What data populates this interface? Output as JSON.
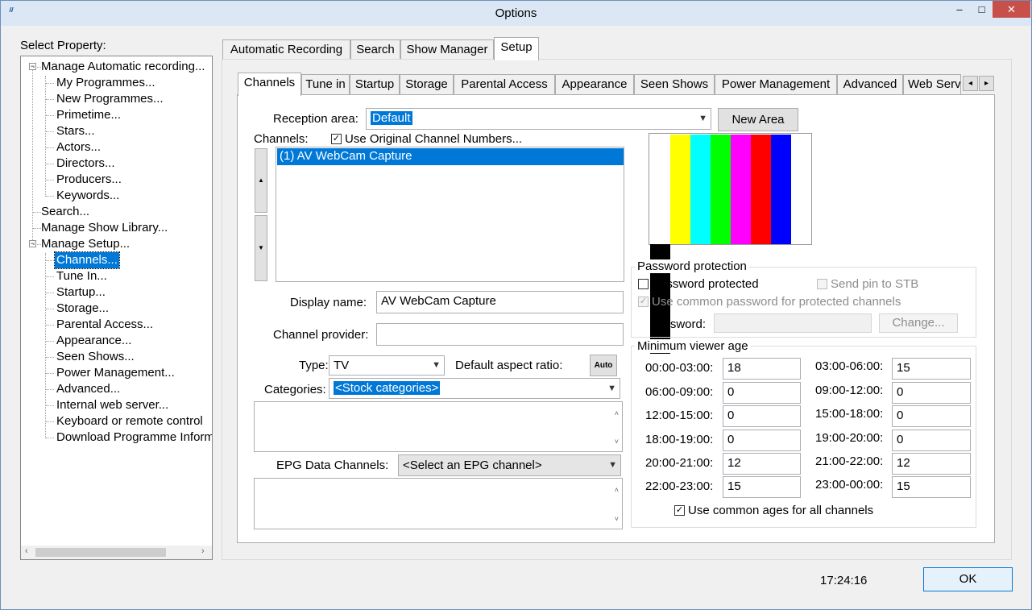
{
  "window": {
    "title": "Options",
    "minimize": "‒",
    "maximize": "□",
    "close": "✕"
  },
  "left": {
    "label": "Select Property:",
    "tree": [
      "Manage Automatic recording...",
      "My Programmes...",
      "New Programmes...",
      "Primetime...",
      "Stars...",
      "Actors...",
      "Directors...",
      "Producers...",
      "Keywords...",
      "Search...",
      "Manage Show Library...",
      "Manage Setup...",
      "Channels...",
      "Tune In...",
      "Startup...",
      "Storage...",
      "Parental Access...",
      "Appearance...",
      "Seen Shows...",
      "Power Management...",
      "Advanced...",
      "Internal web server...",
      "Keyboard or remote control",
      "Download Programme Inform"
    ]
  },
  "outer_tabs": [
    "Automatic Recording",
    "Search",
    "Show Manager",
    "Setup"
  ],
  "inner_tabs": [
    "Channels",
    "Tune in",
    "Startup",
    "Storage",
    "Parental Access",
    "Appearance",
    "Seen Shows",
    "Power Management",
    "Advanced",
    "Web Server"
  ],
  "channels": {
    "reception_label": "Reception area:",
    "reception_value": "Default",
    "new_area": "New Area",
    "channels_label": "Channels:",
    "use_original": "Use Original Channel Numbers...",
    "channel_list": [
      "(1) AV WebCam Capture"
    ],
    "display_name_label": "Display name:",
    "display_name": "AV WebCam Capture",
    "provider_label": "Channel provider:",
    "provider": "",
    "type_label": "Type:",
    "type_value": "TV",
    "aspect_label": "Default aspect ratio:",
    "aspect_btn": "Auto",
    "categories_label": "Categories:",
    "categories_value": "<Stock categories>",
    "epg_label": "EPG Data Channels:",
    "epg_value": "<Select an EPG channel>"
  },
  "colorbars": [
    "#ffffff",
    "#ffff00",
    "#00ffff",
    "#00ff00",
    "#ff00ff",
    "#ff0000",
    "#0000ff",
    "#000000"
  ],
  "password": {
    "group": "Password protection",
    "protected": "Password protected",
    "send_pin": "Send pin to STB",
    "use_common": "Use common password for protected channels",
    "password_label": "Password:",
    "change": "Change..."
  },
  "age": {
    "group": "Minimum viewer age",
    "rows": [
      {
        "l1": "00:00-03:00:",
        "v1": "18",
        "l2": "03:00-06:00:",
        "v2": "15"
      },
      {
        "l1": "06:00-09:00:",
        "v1": "0",
        "l2": "09:00-12:00:",
        "v2": "0"
      },
      {
        "l1": "12:00-15:00:",
        "v1": "0",
        "l2": "15:00-18:00:",
        "v2": "0"
      },
      {
        "l1": "18:00-19:00:",
        "v1": "0",
        "l2": "19:00-20:00:",
        "v2": "0"
      },
      {
        "l1": "20:00-21:00:",
        "v1": "12",
        "l2": "21:00-22:00:",
        "v2": "12"
      },
      {
        "l1": "22:00-23:00:",
        "v1": "15",
        "l2": "23:00-00:00:",
        "v2": "15"
      }
    ],
    "common": "Use common ages for all channels"
  },
  "footer": {
    "time": "17:24:16",
    "ok": "OK"
  }
}
